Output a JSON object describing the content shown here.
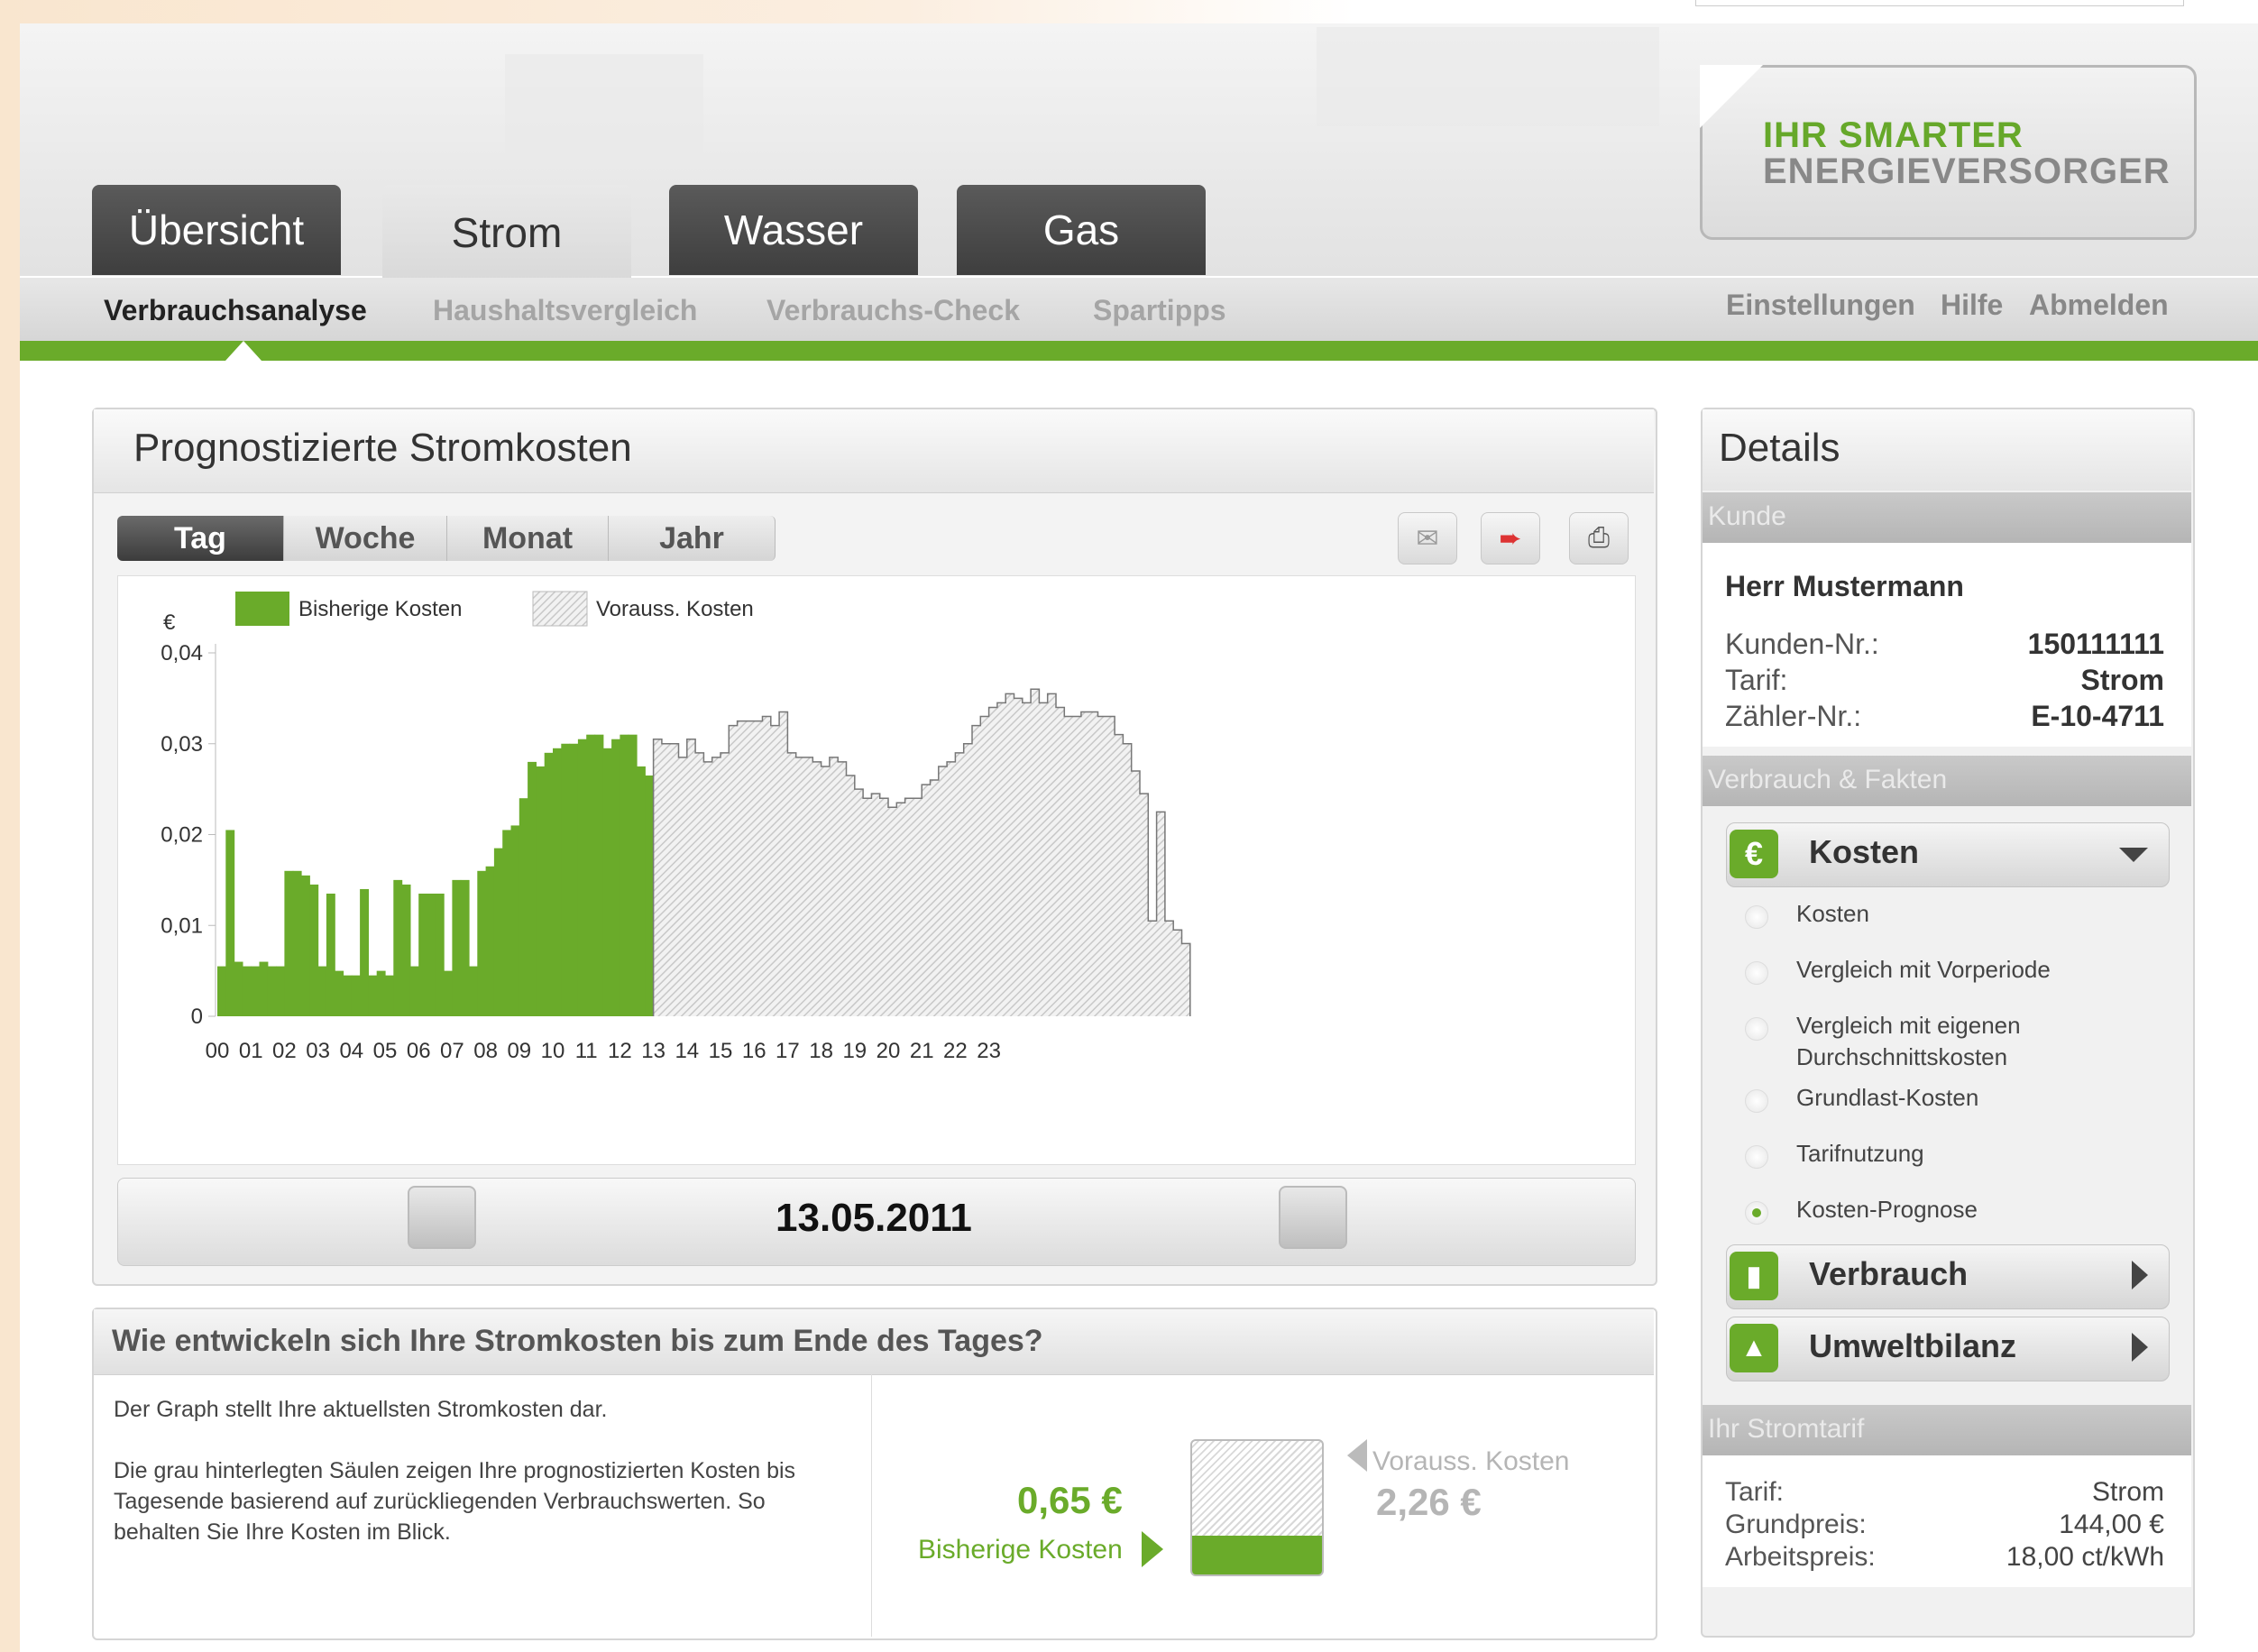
{
  "logo": {
    "line1": "IHR SMARTER",
    "line2": "ENERGIEVERSORGER"
  },
  "tabs": [
    {
      "label": "Übersicht"
    },
    {
      "label": "Strom"
    },
    {
      "label": "Wasser"
    },
    {
      "label": "Gas"
    }
  ],
  "subnav": [
    {
      "label": "Verbrauchsanalyse"
    },
    {
      "label": "Haushaltsvergleich"
    },
    {
      "label": "Verbrauchs-Check"
    },
    {
      "label": "Spartipps"
    }
  ],
  "meta_links": [
    {
      "label": "Einstellungen"
    },
    {
      "label": "Hilfe"
    },
    {
      "label": "Abmelden"
    }
  ],
  "main": {
    "title": "Prognostizierte Stromkosten",
    "periods": [
      {
        "label": "Tag"
      },
      {
        "label": "Woche"
      },
      {
        "label": "Monat"
      },
      {
        "label": "Jahr"
      }
    ],
    "date": "13.05.2011"
  },
  "chart_data": {
    "type": "bar",
    "ylabel": "€",
    "ylim": [
      0,
      0.04
    ],
    "y_ticks": [
      "0",
      "0,01",
      "0,02",
      "0,03",
      "0,04"
    ],
    "x_ticks": [
      "00",
      "01",
      "02",
      "03",
      "04",
      "05",
      "06",
      "07",
      "08",
      "09",
      "10",
      "11",
      "12",
      "13",
      "14",
      "15",
      "16",
      "17",
      "18",
      "19",
      "20",
      "21",
      "22",
      "23"
    ],
    "legend": [
      {
        "name": "Bisherige Kosten",
        "color": "#6aab2a"
      },
      {
        "name": "Vorauss. Kosten",
        "color": "#d4d4d4"
      }
    ],
    "interval_minutes": 15,
    "series": [
      {
        "name": "Bisherige Kosten",
        "start_slot": 0,
        "values": [
          0.0055,
          0.0205,
          0.006,
          0.0055,
          0.0055,
          0.006,
          0.0055,
          0.0055,
          0.016,
          0.016,
          0.0155,
          0.0145,
          0.0055,
          0.0135,
          0.005,
          0.0045,
          0.0045,
          0.014,
          0.0045,
          0.005,
          0.0045,
          0.015,
          0.0145,
          0.0055,
          0.0135,
          0.0135,
          0.0135,
          0.005,
          0.015,
          0.015,
          0.0055,
          0.016,
          0.0165,
          0.0185,
          0.0205,
          0.021,
          0.024,
          0.028,
          0.0275,
          0.029,
          0.0295,
          0.03,
          0.03,
          0.0305,
          0.031,
          0.031,
          0.0295,
          0.0305,
          0.031,
          0.031,
          0.0275,
          0.0265
        ]
      },
      {
        "name": "Vorauss. Kosten",
        "start_slot": 52,
        "values": [
          0.0305,
          0.03,
          0.03,
          0.0285,
          0.0305,
          0.029,
          0.028,
          0.0285,
          0.029,
          0.032,
          0.0325,
          0.0325,
          0.0325,
          0.033,
          0.032,
          0.0335,
          0.029,
          0.0285,
          0.0285,
          0.028,
          0.0275,
          0.0285,
          0.028,
          0.0265,
          0.025,
          0.024,
          0.0245,
          0.024,
          0.023,
          0.0235,
          0.024,
          0.024,
          0.0255,
          0.026,
          0.0275,
          0.028,
          0.029,
          0.03,
          0.032,
          0.033,
          0.034,
          0.0345,
          0.0355,
          0.035,
          0.0345,
          0.036,
          0.0345,
          0.0355,
          0.034,
          0.033,
          0.033,
          0.0335,
          0.0335,
          0.033,
          0.033,
          0.031,
          0.03,
          0.027,
          0.0245,
          0.0105,
          0.0225,
          0.0105,
          0.0095,
          0.008
        ]
      }
    ]
  },
  "bottom": {
    "title": "Wie entwickeln sich Ihre Stromkosten bis zum Ende des Tages?",
    "text1": "Der Graph stellt Ihre aktuellsten Stromkosten dar.",
    "text2": "Die grau hinterlegten Säulen zeigen Ihre prognostizierten Kosten bis Tagesende basierend auf zurückliegenden Verbrauchswerten. So behalten Sie Ihre Kosten im Blick.",
    "current_cost": "0,65 €",
    "current_label": "Bisherige Kosten",
    "forecast_cost": "2,26 €",
    "forecast_label": "Vorauss. Kosten",
    "fill_fraction": 0.29
  },
  "sidebar": {
    "title": "Details",
    "section_customer": "Kunde",
    "customer_name": "Herr Mustermann",
    "customer_fields": [
      {
        "key": "Kunden-Nr.:",
        "value": "150111111"
      },
      {
        "key": "Tarif:",
        "value": "Strom"
      },
      {
        "key": "Zähler-Nr.:",
        "value": "E-10-4711"
      }
    ],
    "section_facts": "Verbrauch & Fakten",
    "accordion": [
      {
        "label": "Kosten",
        "icon": "euro-icon"
      },
      {
        "label": "Verbrauch",
        "icon": "bar-chart-icon"
      },
      {
        "label": "Umweltbilanz",
        "icon": "tree-icon"
      }
    ],
    "options": [
      {
        "label": "Kosten"
      },
      {
        "label": "Vergleich mit Vorperiode"
      },
      {
        "label": "Vergleich mit eigenen Durchschnittskosten"
      },
      {
        "label": "Grundlast-Kosten"
      },
      {
        "label": "Tarifnutzung"
      },
      {
        "label": "Kosten-Prognose"
      }
    ],
    "selected_option": "Kosten-Prognose",
    "section_tariff": "Ihr Stromtarif",
    "tariff_fields": [
      {
        "key": "Tarif:",
        "value": "Strom"
      },
      {
        "key": "Grundpreis:",
        "value": "144,00 €"
      },
      {
        "key": "Arbeitspreis:",
        "value": "18,00 ct/kWh"
      }
    ]
  },
  "colors": {
    "brand_green": "#6aab2a",
    "forecast_grey": "#d4d4d4"
  }
}
